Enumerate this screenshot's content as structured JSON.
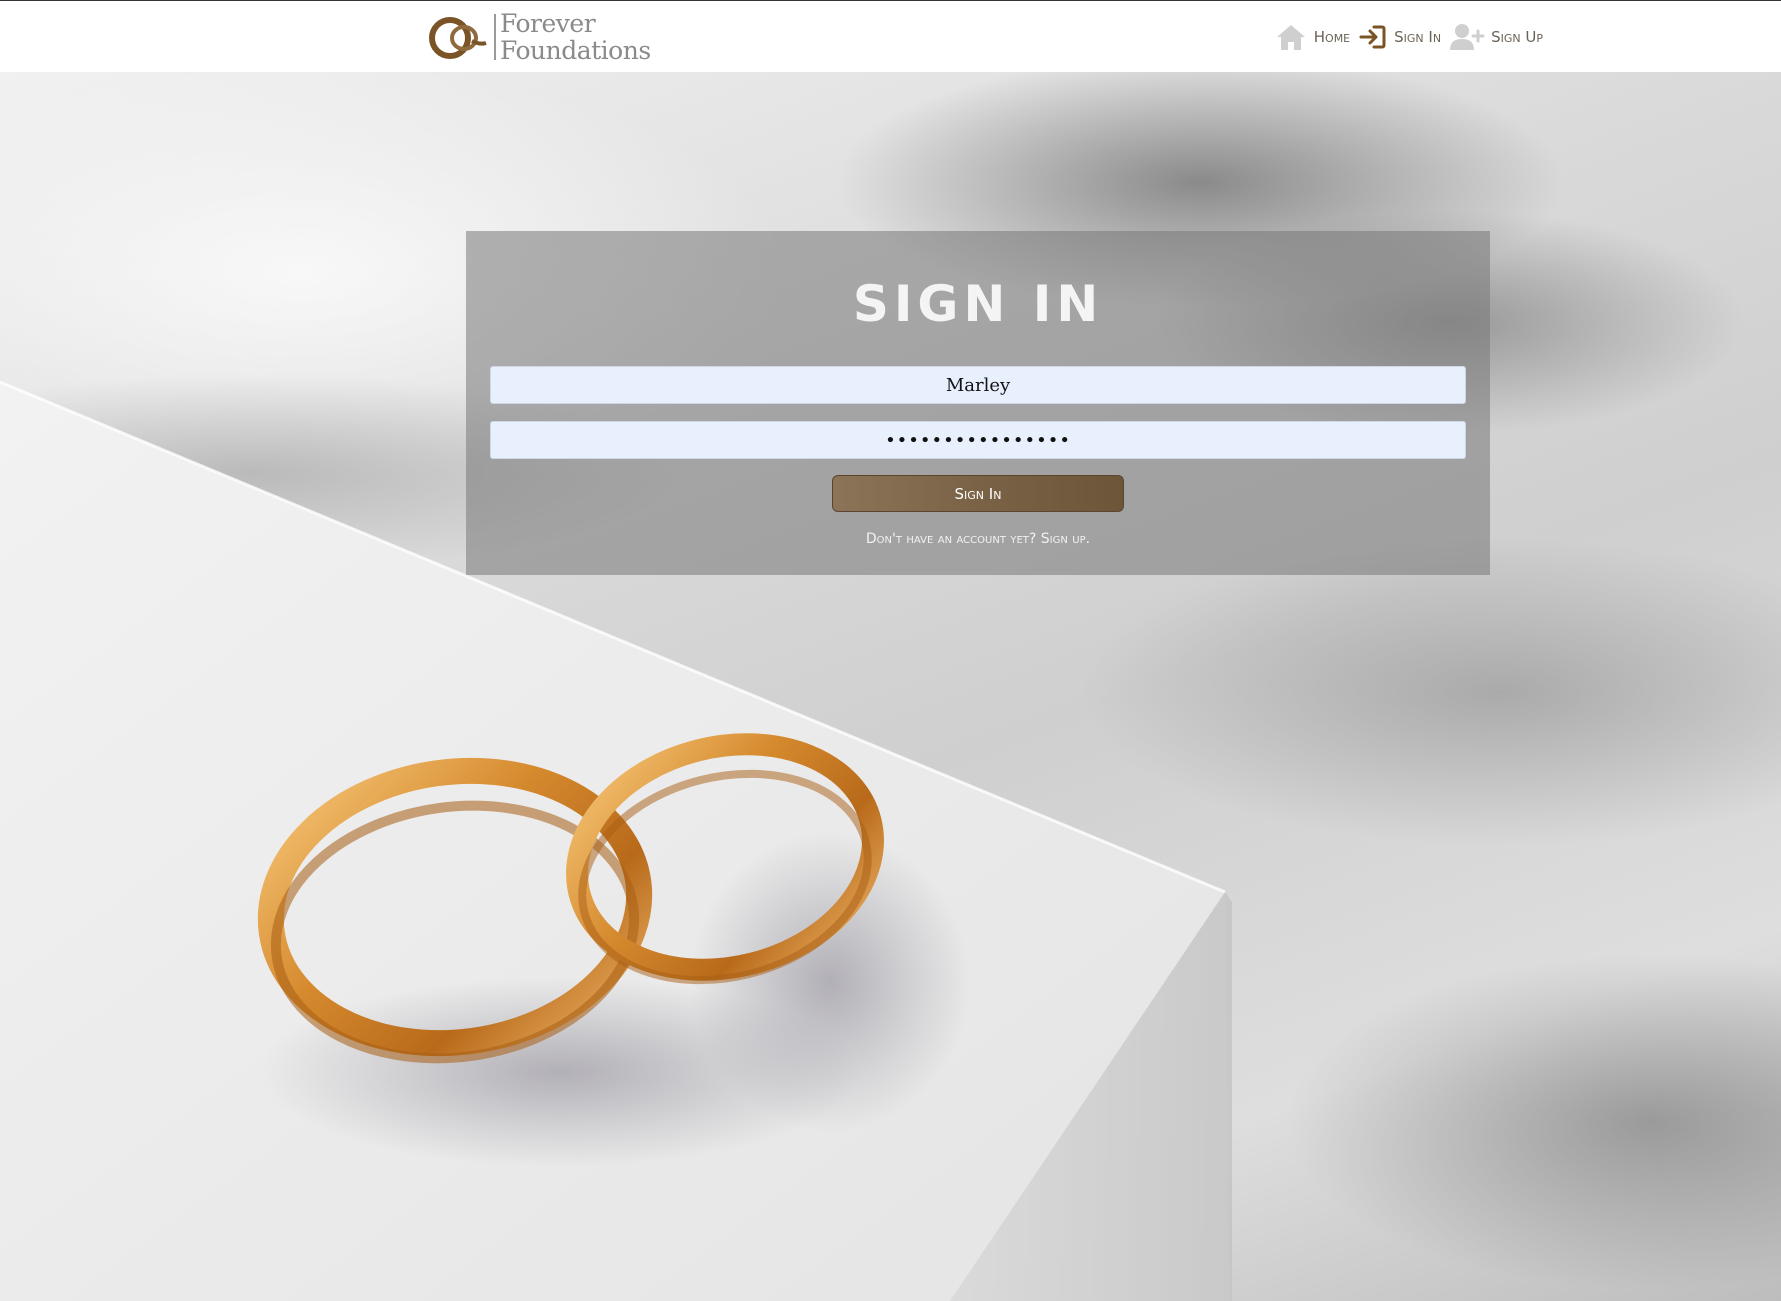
{
  "brand": {
    "name_line1": "Forever",
    "name_line2": "Foundations",
    "logo_icon": "interlocked-rings-logo"
  },
  "nav": {
    "items": [
      {
        "label": "Home",
        "icon": "home-icon"
      },
      {
        "label": "Sign In",
        "icon": "sign-in-icon"
      },
      {
        "label": "Sign Up",
        "icon": "user-plus-icon"
      }
    ]
  },
  "signin": {
    "title": "SIGN IN",
    "username_value": "Marley",
    "password_value": "••••••••••••••••",
    "submit_label": "Sign In",
    "signup_prompt": "Don't have an account yet? Sign up."
  },
  "colors": {
    "accent": "#7a6246",
    "nav_text": "#6b6256",
    "field_bg": "#e8f0fe",
    "panel_bg": "rgba(120,120,120,0.55)"
  }
}
